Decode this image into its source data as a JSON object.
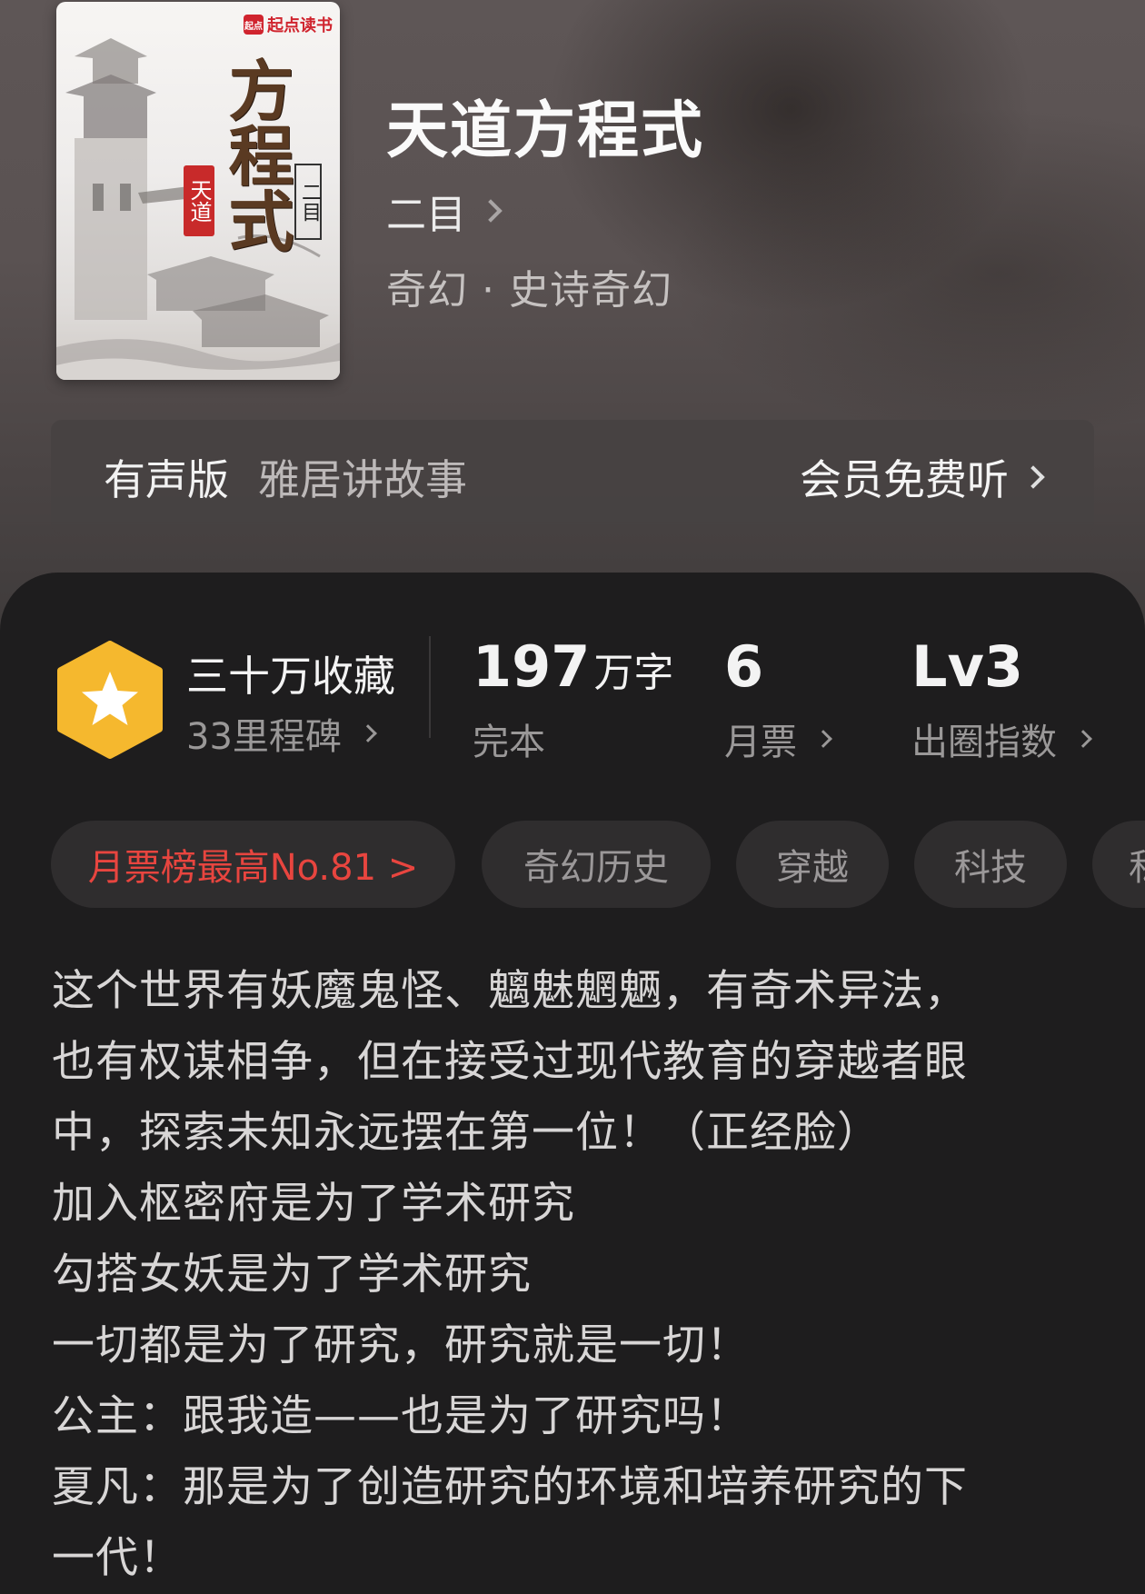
{
  "book": {
    "cover_brand": "起点读书",
    "cover_brand_logo": "起点",
    "cover_title": "方程式",
    "cover_seal": "天道",
    "cover_author": "二目",
    "title": "天道方程式",
    "author": "二目",
    "genre": "奇幻 · 史诗奇幻"
  },
  "audio": {
    "label": "有声版",
    "narrator": "雅居讲故事",
    "action": "会员免费听"
  },
  "stats": {
    "milestone_title": "三十万收藏",
    "milestone_sub": "33里程碑",
    "words_number": "197",
    "words_unit": "万字",
    "words_status": "完本",
    "monthly_votes": "6",
    "monthly_votes_label": "月票",
    "level": "Lv3",
    "level_label": "出圈指数"
  },
  "tags": {
    "rank": "月票榜最高No.81 >",
    "t1": "奇幻历史",
    "t2": "穿越",
    "t3": "科技",
    "t4": "私"
  },
  "synopsis": {
    "l1": "这个世界有妖魔鬼怪、魑魅魍魉，有奇术异法，",
    "l2": "也有权谋相争，但在接受过现代教育的穿越者眼",
    "l3": "中，探索未知永远摆在第一位！（正经脸）",
    "l4": "加入枢密府是为了学术研究",
    "l5": "勾搭女妖是为了学术研究",
    "l6": "一切都是为了研究，研究就是一切！",
    "l7": "公主：跟我造——也是为了研究吗！",
    "l8": "夏凡：那是为了创造研究的环境和培养研究的下",
    "l9": "一代！"
  },
  "colors": {
    "accent_rank": "#e8453f",
    "milestone_badge": "#f5b82e",
    "panel_bg": "#1e1d1e"
  },
  "icons": {
    "milestone": "star-hexagon-icon",
    "chevron": "chevron-right-icon"
  }
}
